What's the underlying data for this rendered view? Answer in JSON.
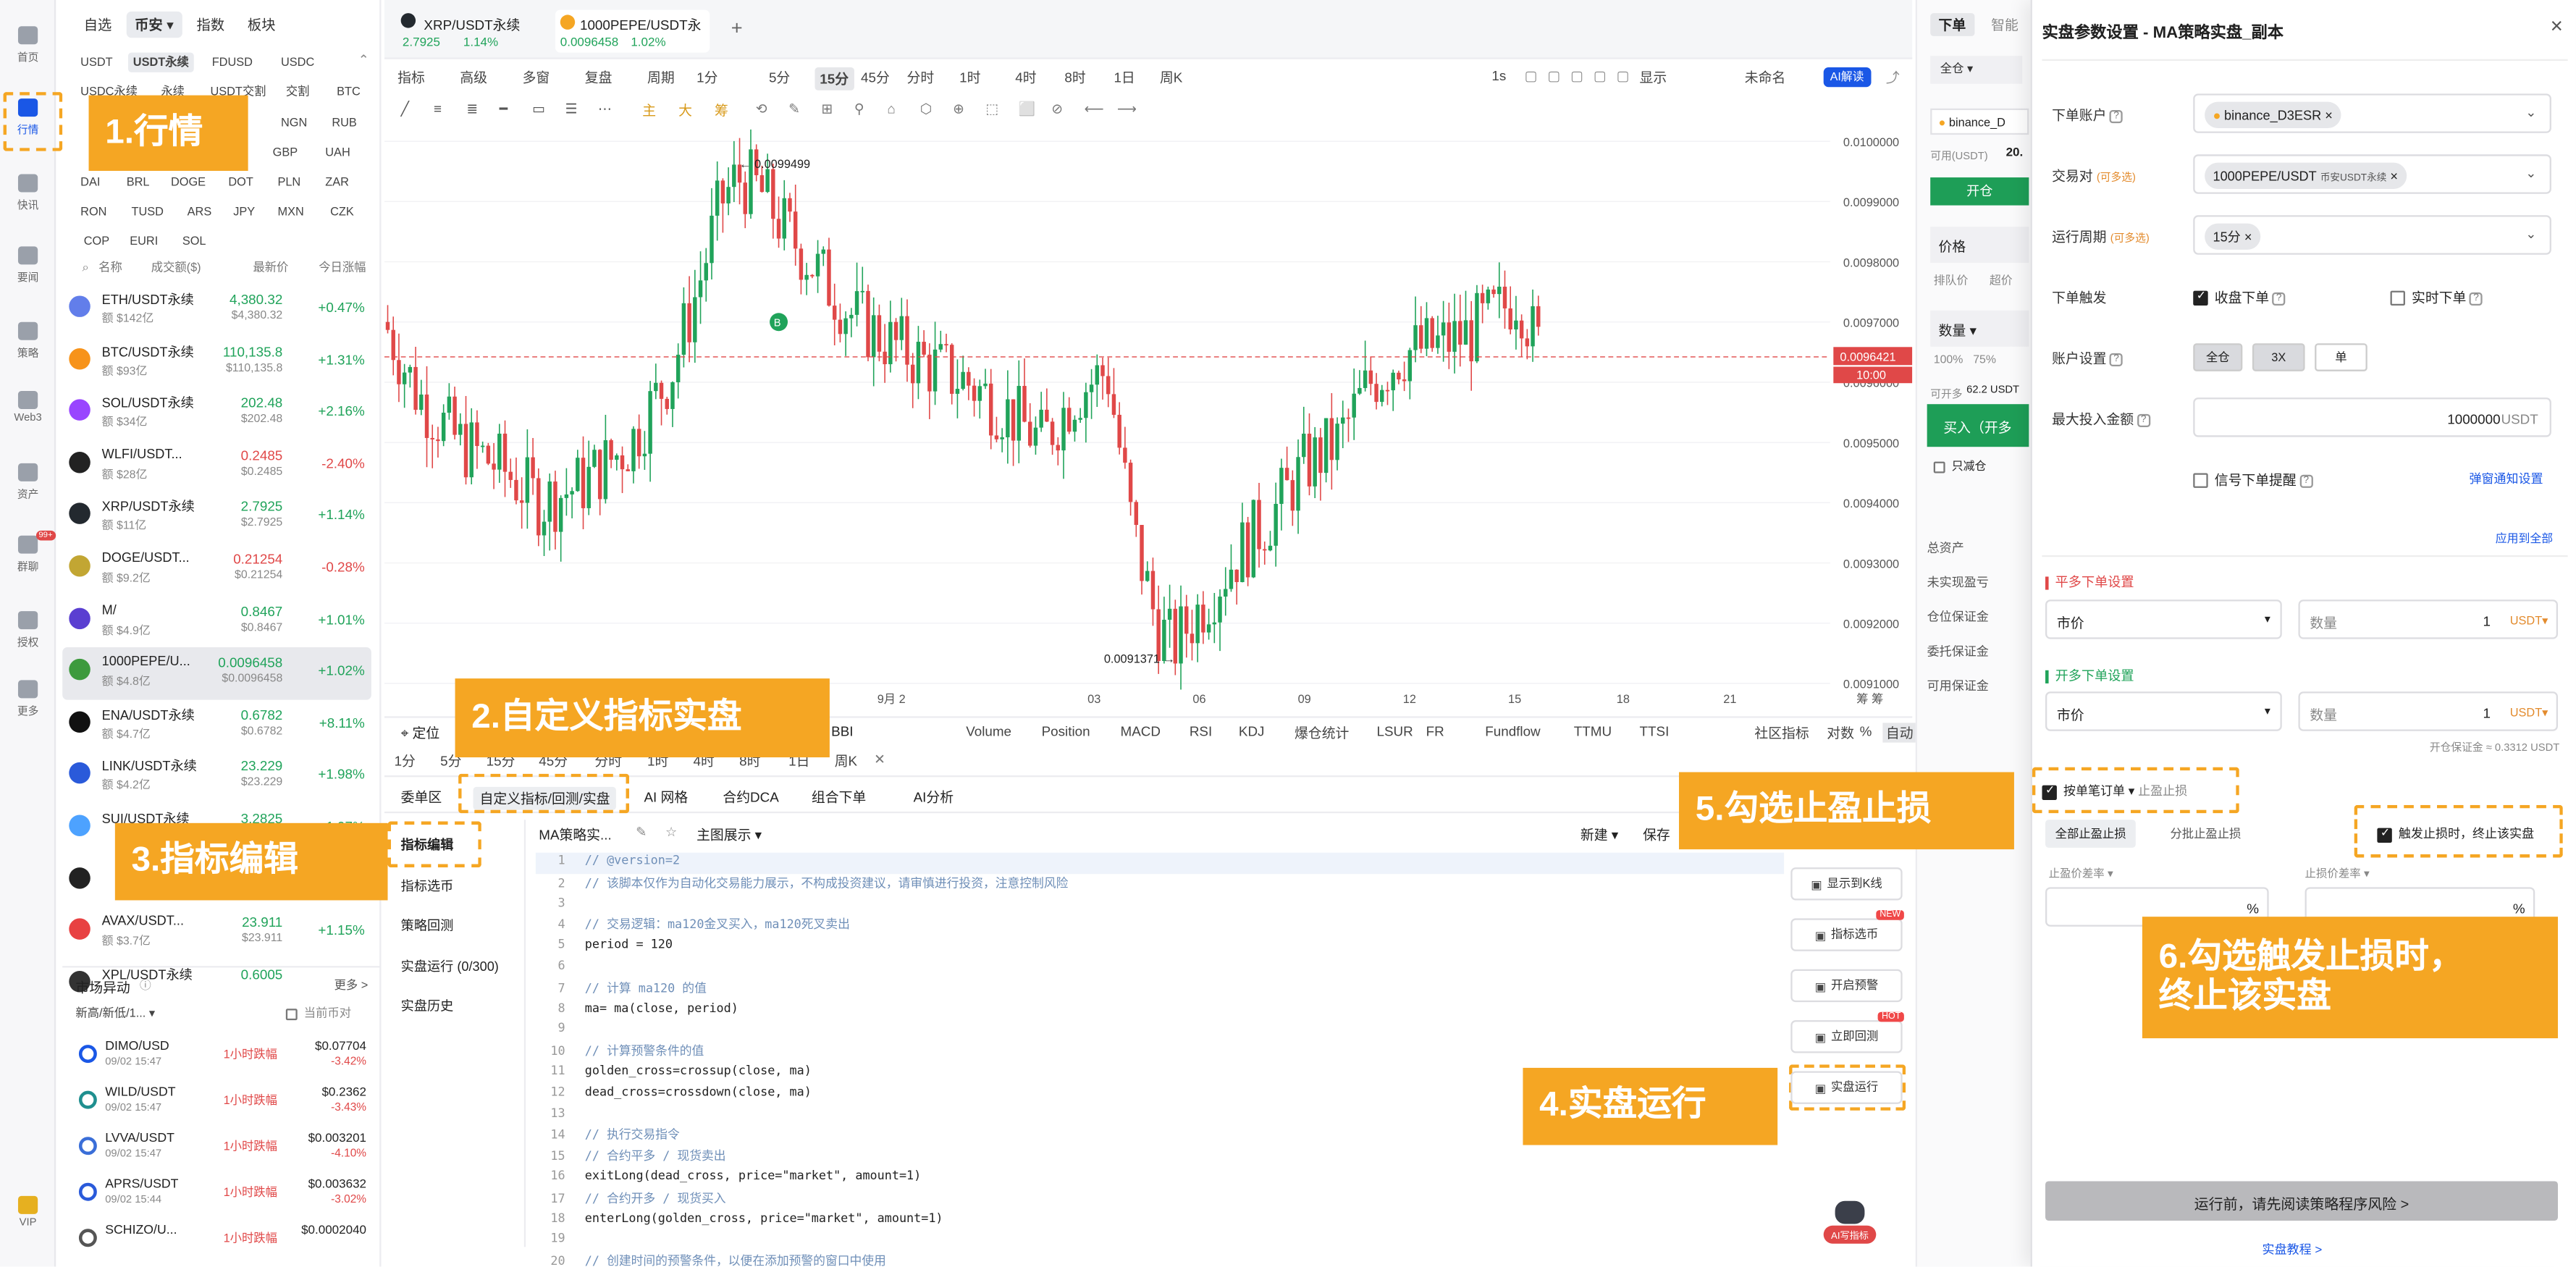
{
  "rail": [
    {
      "label": "首页",
      "icon": "home-icon"
    },
    {
      "label": "行情",
      "icon": "chart-icon"
    },
    {
      "label": "快讯",
      "icon": "news-icon"
    },
    {
      "label": "要闻",
      "icon": "article-icon"
    },
    {
      "label": "策略",
      "icon": "strategy-icon"
    },
    {
      "label": "Web3",
      "icon": "web3-icon"
    },
    {
      "label": "资产",
      "icon": "wallet-icon"
    },
    {
      "label": "群聊",
      "icon": "chat-icon",
      "badge": "99+"
    },
    {
      "label": "授权",
      "icon": "auth-icon"
    },
    {
      "label": "更多",
      "icon": "more-icon"
    },
    {
      "label": "VIP",
      "icon": "vip-icon"
    }
  ],
  "market": {
    "tabs": [
      "自选",
      "币安",
      "指数",
      "板块"
    ],
    "chips_row1": [
      "USDT",
      "USDT永续",
      "FDUSD",
      "USDC"
    ],
    "chips_row2": [
      "USDC永续",
      "永续",
      "USDT交割",
      "交割",
      "BTC"
    ],
    "chips_row3": [
      "NGN",
      "RUB"
    ],
    "chips_row4": [
      "GBP",
      "UAH"
    ],
    "chips_row5": [
      "DAI",
      "BRL",
      "DOGE",
      "DOT",
      "PLN",
      "ZAR"
    ],
    "chips_row6": [
      "RON",
      "TUSD",
      "ARS",
      "JPY",
      "MXN",
      "CZK"
    ],
    "chips_row7": [
      "COP",
      "EURI",
      "SOL"
    ],
    "header": {
      "name": "名称",
      "vol": "成交额($)",
      "price": "最新价",
      "chg": "今日涨幅"
    },
    "rows": [
      {
        "name": "ETH/USDT永续",
        "vol": "额 $142亿",
        "price": "4,380.32",
        "price2": "$4,380.32",
        "chg": "+0.47%",
        "up": true,
        "color": "#627eea"
      },
      {
        "name": "BTC/USDT永续",
        "vol": "额 $93亿",
        "price": "110,135.8",
        "price2": "$110,135.8",
        "chg": "+1.31%",
        "up": true,
        "color": "#f7931a"
      },
      {
        "name": "SOL/USDT永续",
        "vol": "额 $34亿",
        "price": "202.48",
        "price2": "$202.48",
        "chg": "+2.16%",
        "up": true,
        "color": "#9945ff"
      },
      {
        "name": "WLFI/USDT...",
        "vol": "额 $28亿",
        "price": "0.2485",
        "price2": "$0.2485",
        "chg": "-2.40%",
        "up": false,
        "color": "#222222"
      },
      {
        "name": "XRP/USDT永续",
        "vol": "额 $11亿",
        "price": "2.7925",
        "price2": "$2.7925",
        "chg": "+1.14%",
        "up": true,
        "color": "#23292f"
      },
      {
        "name": "DOGE/USDT...",
        "vol": "额 $9.2亿",
        "price": "0.21254",
        "price2": "$0.21254",
        "chg": "-0.28%",
        "up": false,
        "color": "#c2a633"
      },
      {
        "name": "M/",
        "vol": "额 $4.9亿",
        "price": "0.8467",
        "price2": "$0.8467",
        "chg": "+1.01%",
        "up": true,
        "color": "#5a3fd1"
      },
      {
        "name": "1000PEPE/U...",
        "vol": "额 $4.8亿",
        "price": "0.0096458",
        "price2": "$0.0096458",
        "chg": "+1.02%",
        "up": true,
        "color": "#3d9a3d",
        "selected": true
      },
      {
        "name": "ENA/USDT永续",
        "vol": "额 $4.7亿",
        "price": "0.6782",
        "price2": "$0.6782",
        "chg": "+8.11%",
        "up": true,
        "color": "#111111"
      },
      {
        "name": "LINK/USDT永续",
        "vol": "额 $4.2亿",
        "price": "23.229",
        "price2": "$23.229",
        "chg": "+1.98%",
        "up": true,
        "color": "#2a5ada"
      },
      {
        "name": "SUI/USDT永续",
        "vol": "",
        "price": "3.2825",
        "price2": "",
        "chg": "+1.97%",
        "up": true,
        "color": "#4da2ff"
      },
      {
        "name": "",
        "vol": "",
        "price": "",
        "price2": "",
        "chg": "",
        "up": true,
        "color": "#222222"
      },
      {
        "name": "AVAX/USDT...",
        "vol": "额 $3.7亿",
        "price": "23.911",
        "price2": "$23.911",
        "chg": "+1.15%",
        "up": true,
        "color": "#e84142"
      },
      {
        "name": "XPL/USDT永续",
        "vol": "",
        "price": "0.6005",
        "price2": "",
        "chg": "",
        "up": true,
        "color": "#333333"
      }
    ],
    "movers_title": "市场异动",
    "movers_more": "更多 >",
    "movers_filter": "新高/新低/1...",
    "movers_current": "当前币对",
    "movers": [
      {
        "name": "DIMO/USD",
        "time": "09/02 15:47",
        "tag": "1小时跌幅",
        "price": "$0.07704",
        "chg": "-3.42%",
        "color": "#1a57e6"
      },
      {
        "name": "WILD/USDT",
        "time": "09/02 15:47",
        "tag": "1小时跌幅",
        "price": "$0.2362",
        "chg": "-3.43%",
        "color": "#1f8f8f"
      },
      {
        "name": "LVVA/USDT",
        "time": "09/02 15:47",
        "tag": "1小时跌幅",
        "price": "$0.003201",
        "chg": "-4.10%",
        "color": "#3a6ed8"
      },
      {
        "name": "APRS/USDT",
        "time": "09/02 15:44",
        "tag": "1小时跌幅",
        "price": "$0.003632",
        "chg": "-3.02%",
        "color": "#2a5ada"
      },
      {
        "name": "SCHIZO/U...",
        "time": "",
        "tag": "1小时跌幅",
        "price": "$0.0002040",
        "chg": "",
        "color": "#555555"
      }
    ]
  },
  "chart": {
    "tabs": [
      {
        "name": "XRP/USDT永续",
        "price": "2.7925",
        "chg": "1.14%"
      },
      {
        "name": "1000PEPE/USDT永",
        "price": "0.0096458",
        "chg": "1.02%"
      }
    ],
    "add_tab": "+",
    "toolbar1": [
      "指标",
      "高级",
      "多窗",
      "复盘",
      "周期",
      "1分",
      "5分",
      "15分",
      "45分",
      "分时",
      "1时",
      "4时",
      "8时",
      "1日",
      "周K"
    ],
    "toolbar1_right": [
      "1s",
      "显示",
      "未命名",
      "AI解读"
    ],
    "toolbar2_txt": [
      "主",
      "大",
      "筹"
    ],
    "high_label": "← 0.0099499",
    "low_label": "0.0091371 →",
    "last_price": "0.0096421",
    "countdown": "10:00",
    "marker_b": "B",
    "y_ticks": [
      "0.0100000",
      "0.0099000",
      "0.0098000",
      "0.0097000",
      "0.0096000",
      "0.0095000",
      "0.0094000",
      "0.0093000",
      "0.0092000",
      "0.0091000"
    ],
    "x_ticks": [
      "21",
      "9月 2",
      "03",
      "06",
      "09",
      "12",
      "15",
      "18",
      "21"
    ],
    "y_axis_right_label": "筹 筹",
    "locate": "定位",
    "indicators": [
      "Volume",
      "Position",
      "MACD",
      "RSI",
      "KDJ",
      "爆仓统计",
      "LSUR",
      "FR",
      "Fundflow",
      "TTMU",
      "TTSI"
    ],
    "indicator_right": [
      "社区指标",
      "对数",
      "%",
      "自动"
    ],
    "bbi": "BBI",
    "periods2": [
      "1分",
      "5分",
      "15分",
      "45分",
      "分时",
      "1时",
      "4时",
      "8时",
      "1日",
      "周K"
    ]
  },
  "bottom": {
    "tabs": [
      "委单区",
      "自定义指标/回测/实盘",
      "AI 网格",
      "合约DCA",
      "组合下单",
      "AI分析"
    ],
    "side_menu": [
      "指标编辑",
      "指标选币",
      "策略回测",
      "实盘运行 (0/300)",
      "实盘历史"
    ],
    "script_name": "MA策略实...",
    "main_display": "主图展示",
    "new_btn": "新建",
    "save_btn": "保存",
    "code": [
      {
        "t": "// @version=2",
        "c": "cm"
      },
      {
        "t": "// 该脚本仅作为自动化交易能力展示，不构成投资建议，请审慎进行投资，注意控制风险",
        "c": "cm"
      },
      {
        "t": "",
        "c": ""
      },
      {
        "t": "// 交易逻辑：ma120金叉买入，ma120死叉卖出",
        "c": "cm"
      },
      {
        "t": "period = 120",
        "c": "p"
      },
      {
        "t": "",
        "c": ""
      },
      {
        "t": "// 计算 ma120 的值",
        "c": "cm"
      },
      {
        "t": "ma= ma(close, period)",
        "c": "f"
      },
      {
        "t": "",
        "c": ""
      },
      {
        "t": "// 计算预警条件的值",
        "c": "cm"
      },
      {
        "t": "golden_cross=crossup(close, ma)",
        "c": "f"
      },
      {
        "t": "dead_cross=crossdown(close, ma)",
        "c": "f"
      },
      {
        "t": "",
        "c": ""
      },
      {
        "t": "// 执行交易指令",
        "c": "cm"
      },
      {
        "t": "// 合约平多 / 现货卖出",
        "c": "cm"
      },
      {
        "t": "exitLong(dead_cross, price=\"market\", amount=1)",
        "c": "f"
      },
      {
        "t": "// 合约开多 / 现货买入",
        "c": "cm"
      },
      {
        "t": "enterLong(golden_cross, price=\"market\", amount=1)",
        "c": "f"
      },
      {
        "t": "",
        "c": ""
      },
      {
        "t": "// 创建时间的预警条件，以便在添加预警的窗口中使用",
        "c": "cm"
      }
    ],
    "side_buttons": [
      {
        "label": "显示到K线",
        "icon": "kline-icon"
      },
      {
        "label": "指标选币",
        "icon": "filter-icon",
        "badge": "NEW"
      },
      {
        "label": "开启预警",
        "icon": "alarm-icon"
      },
      {
        "label": "立即回测",
        "icon": "backtest-icon",
        "badge": "HOT"
      },
      {
        "label": "实盘运行",
        "icon": "run-icon"
      }
    ],
    "ai_label": "AI写指标"
  },
  "order": {
    "tabs": [
      "下单",
      "智能"
    ],
    "full": "全仓",
    "account": "binance_D",
    "avail": "可用(USDT)",
    "avail_val": "20.",
    "open": "开仓",
    "price": "价格",
    "queue": "排队价",
    "qty": "数量",
    "pcts": [
      "100%",
      "75%"
    ],
    "can_open": "可开多",
    "can_open_val": "62.2 USDT",
    "buy": "买入（开多",
    "reduce": "只减仓",
    "stats": [
      "总资产",
      "未实现盈亏",
      "仓位保证金",
      "委托保证金",
      "可用保证金"
    ]
  },
  "dialog": {
    "title": "实盘参数设置 - MA策略实盘_副本",
    "close": "×",
    "account_label": "下单账户",
    "account_tag": "binance_D3ESR",
    "pair_label": "交易对",
    "pair_hint": "(可多选)",
    "pair_tag": "1000PEPE/USDT",
    "pair_sub": "币安USDT永续",
    "period_label": "运行周期",
    "period_hint": "(可多选)",
    "period_tag": "15分",
    "trigger_label": "下单触发",
    "trigger_close": "收盘下单",
    "trigger_realtime": "实时下单",
    "acct_setting_label": "账户设置",
    "acct_segs": [
      "全仓",
      "3X",
      "单"
    ],
    "max_label": "最大投入金额",
    "max_value": "1000000",
    "max_unit": "USDT",
    "signal_remind": "信号下单提醒",
    "popup_setting": "弹窗通知设置",
    "apply_all": "应用到全部",
    "close_long_title": "平多下单设置",
    "open_long_title": "开多下单设置",
    "market": "市价",
    "qty": "数量",
    "qty_val": "1",
    "qty_unit": "USDT",
    "margin_note": "开仓保证金 ≈ 0.3312 USDT",
    "per_order": "按单笔订单",
    "tp_sl": "止盈止损",
    "all_tp_sl": "全部止盈止损",
    "partial_tp_sl": "分批止盈止损",
    "stop_on_sl": "触发止损时，终止该实盘",
    "tp_diff": "止盈价差率",
    "sl_diff": "止损价差率",
    "pct": "%",
    "run_btn": "运行前，请先阅读策略程序风险 >",
    "tutorial": "实盘教程 >"
  },
  "annotations": [
    "1.行情",
    "2.自定义指标实盘",
    "3.指标编辑",
    "4.实盘运行",
    "5.勾选止盈止损",
    "6.勾选触发止损时，",
    "终止该实盘"
  ],
  "colors": {
    "accent": "#1a57e6",
    "up": "#20a35a",
    "down": "#e04848",
    "annotation": "#f5a623",
    "buy": "#1e9e57"
  }
}
